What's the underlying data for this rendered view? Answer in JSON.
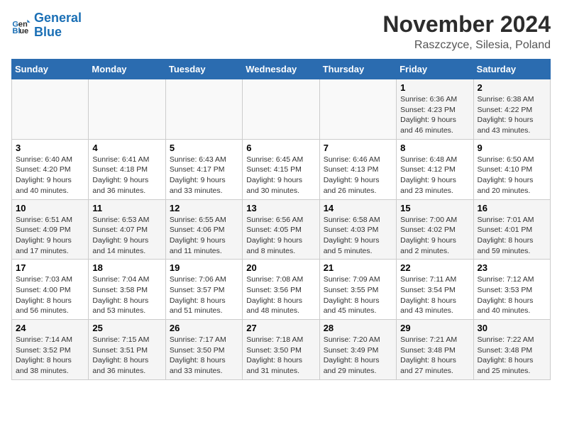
{
  "logo": {
    "line1": "General",
    "line2": "Blue"
  },
  "title": "November 2024",
  "location": "Raszczyce, Silesia, Poland",
  "weekdays": [
    "Sunday",
    "Monday",
    "Tuesday",
    "Wednesday",
    "Thursday",
    "Friday",
    "Saturday"
  ],
  "weeks": [
    [
      {
        "day": "",
        "info": ""
      },
      {
        "day": "",
        "info": ""
      },
      {
        "day": "",
        "info": ""
      },
      {
        "day": "",
        "info": ""
      },
      {
        "day": "",
        "info": ""
      },
      {
        "day": "1",
        "info": "Sunrise: 6:36 AM\nSunset: 4:23 PM\nDaylight: 9 hours\nand 46 minutes."
      },
      {
        "day": "2",
        "info": "Sunrise: 6:38 AM\nSunset: 4:22 PM\nDaylight: 9 hours\nand 43 minutes."
      }
    ],
    [
      {
        "day": "3",
        "info": "Sunrise: 6:40 AM\nSunset: 4:20 PM\nDaylight: 9 hours\nand 40 minutes."
      },
      {
        "day": "4",
        "info": "Sunrise: 6:41 AM\nSunset: 4:18 PM\nDaylight: 9 hours\nand 36 minutes."
      },
      {
        "day": "5",
        "info": "Sunrise: 6:43 AM\nSunset: 4:17 PM\nDaylight: 9 hours\nand 33 minutes."
      },
      {
        "day": "6",
        "info": "Sunrise: 6:45 AM\nSunset: 4:15 PM\nDaylight: 9 hours\nand 30 minutes."
      },
      {
        "day": "7",
        "info": "Sunrise: 6:46 AM\nSunset: 4:13 PM\nDaylight: 9 hours\nand 26 minutes."
      },
      {
        "day": "8",
        "info": "Sunrise: 6:48 AM\nSunset: 4:12 PM\nDaylight: 9 hours\nand 23 minutes."
      },
      {
        "day": "9",
        "info": "Sunrise: 6:50 AM\nSunset: 4:10 PM\nDaylight: 9 hours\nand 20 minutes."
      }
    ],
    [
      {
        "day": "10",
        "info": "Sunrise: 6:51 AM\nSunset: 4:09 PM\nDaylight: 9 hours\nand 17 minutes."
      },
      {
        "day": "11",
        "info": "Sunrise: 6:53 AM\nSunset: 4:07 PM\nDaylight: 9 hours\nand 14 minutes."
      },
      {
        "day": "12",
        "info": "Sunrise: 6:55 AM\nSunset: 4:06 PM\nDaylight: 9 hours\nand 11 minutes."
      },
      {
        "day": "13",
        "info": "Sunrise: 6:56 AM\nSunset: 4:05 PM\nDaylight: 9 hours\nand 8 minutes."
      },
      {
        "day": "14",
        "info": "Sunrise: 6:58 AM\nSunset: 4:03 PM\nDaylight: 9 hours\nand 5 minutes."
      },
      {
        "day": "15",
        "info": "Sunrise: 7:00 AM\nSunset: 4:02 PM\nDaylight: 9 hours\nand 2 minutes."
      },
      {
        "day": "16",
        "info": "Sunrise: 7:01 AM\nSunset: 4:01 PM\nDaylight: 8 hours\nand 59 minutes."
      }
    ],
    [
      {
        "day": "17",
        "info": "Sunrise: 7:03 AM\nSunset: 4:00 PM\nDaylight: 8 hours\nand 56 minutes."
      },
      {
        "day": "18",
        "info": "Sunrise: 7:04 AM\nSunset: 3:58 PM\nDaylight: 8 hours\nand 53 minutes."
      },
      {
        "day": "19",
        "info": "Sunrise: 7:06 AM\nSunset: 3:57 PM\nDaylight: 8 hours\nand 51 minutes."
      },
      {
        "day": "20",
        "info": "Sunrise: 7:08 AM\nSunset: 3:56 PM\nDaylight: 8 hours\nand 48 minutes."
      },
      {
        "day": "21",
        "info": "Sunrise: 7:09 AM\nSunset: 3:55 PM\nDaylight: 8 hours\nand 45 minutes."
      },
      {
        "day": "22",
        "info": "Sunrise: 7:11 AM\nSunset: 3:54 PM\nDaylight: 8 hours\nand 43 minutes."
      },
      {
        "day": "23",
        "info": "Sunrise: 7:12 AM\nSunset: 3:53 PM\nDaylight: 8 hours\nand 40 minutes."
      }
    ],
    [
      {
        "day": "24",
        "info": "Sunrise: 7:14 AM\nSunset: 3:52 PM\nDaylight: 8 hours\nand 38 minutes."
      },
      {
        "day": "25",
        "info": "Sunrise: 7:15 AM\nSunset: 3:51 PM\nDaylight: 8 hours\nand 36 minutes."
      },
      {
        "day": "26",
        "info": "Sunrise: 7:17 AM\nSunset: 3:50 PM\nDaylight: 8 hours\nand 33 minutes."
      },
      {
        "day": "27",
        "info": "Sunrise: 7:18 AM\nSunset: 3:50 PM\nDaylight: 8 hours\nand 31 minutes."
      },
      {
        "day": "28",
        "info": "Sunrise: 7:20 AM\nSunset: 3:49 PM\nDaylight: 8 hours\nand 29 minutes."
      },
      {
        "day": "29",
        "info": "Sunrise: 7:21 AM\nSunset: 3:48 PM\nDaylight: 8 hours\nand 27 minutes."
      },
      {
        "day": "30",
        "info": "Sunrise: 7:22 AM\nSunset: 3:48 PM\nDaylight: 8 hours\nand 25 minutes."
      }
    ]
  ]
}
